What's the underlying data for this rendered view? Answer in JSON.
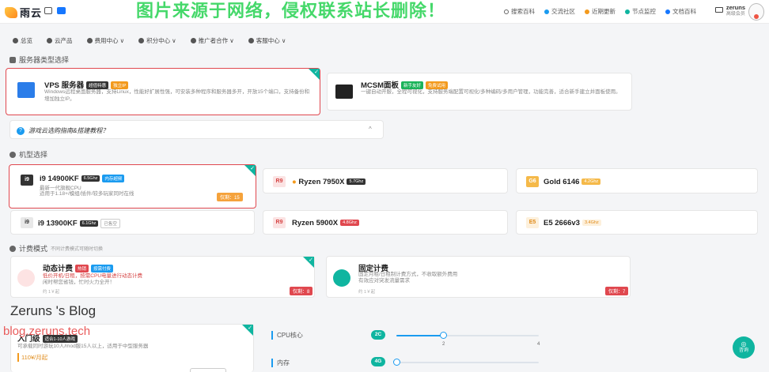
{
  "topbar": {
    "brand": "雨云",
    "watermark": "图片来源于网络，侵权联系站长删除！",
    "links": [
      "搜索百科",
      "交流社区",
      "近期更新",
      "节点监控",
      "文档百科"
    ],
    "link_colors": [
      "#666666",
      "#1a9bf0",
      "#f39a1d",
      "#0fb5a0",
      "#1677ff"
    ],
    "user_name": "zeruns",
    "user_sub": "高级会员"
  },
  "nav": [
    "总览",
    "云产品",
    "费用中心 ∨",
    "积分中心 ∨",
    "推广者合作 ∨",
    "客服中心 ∨"
  ],
  "server_type": {
    "title": "服务器类型选择",
    "cards": [
      {
        "title": "VPS 服务器",
        "badges": [
          "超值特惠",
          "独立IP"
        ],
        "desc": "Windows远程桌面服务器，支持Linux，性能好扩展性强，可安装多种程序和服务器多开，开放15个端口，支持备份和增加独立IP。"
      },
      {
        "title": "MCSM面板",
        "badges": [
          "新手友好",
          "免费试用"
        ],
        "desc": "一键自动开服，全程可视化，支持服务端配置可视化/多种编码/多用户管理，功能完善，适合新手建立并面板使用。"
      }
    ]
  },
  "help": {
    "text": "游戏云选购指南&搭建教程？",
    "chevron": "^"
  },
  "cpu": {
    "title": "机型选择",
    "cards": [
      {
        "chip": "i9",
        "name": "i9 14900KF",
        "badges": [
          "6.5Ghz",
          "内存超频"
        ],
        "desc1": "最新一代旗舰CPU",
        "desc2": "适用于1.18+/模组/插件/较多玩家同时在线",
        "price": "仅剩：15"
      },
      {
        "chip": "R9",
        "name": "Ryzen 7950X",
        "badges": [
          "5.7Ghz"
        ]
      },
      {
        "chip": "G6",
        "name": "Gold 6146",
        "badges": [
          "4.2Ghz"
        ]
      },
      {
        "chip": "i9",
        "name": "i9 13900KF",
        "badges": [
          "6.1Ghz",
          "已售空"
        ]
      },
      {
        "chip": "R9",
        "name": "Ryzen 5900X",
        "badges": [
          "4.8Ghz"
        ]
      },
      {
        "chip": "E5",
        "name": "E5 2666v3",
        "badges": [
          "3.4Ghz"
        ]
      }
    ]
  },
  "billing": {
    "title": "计费模式",
    "subtitle": "不同计费模式可随时切换",
    "cards": [
      {
        "title": "动态计费",
        "badges": [
          "热销",
          "按需付费"
        ],
        "line1": "低价开机/日租，按需CPU电量进行动态计费",
        "line2": "闲时帮您省钱，忙时火力全开！",
        "note": "约 1￥起",
        "price": "仅剩：8"
      },
      {
        "title": "固定计费",
        "line1": "固定月租/日租制计费方式，不收取额外费用",
        "line2": "有效应对突发流量需求",
        "note": "约 1￥起",
        "price": "仅剩：7"
      }
    ]
  },
  "blog": {
    "title": "Zeruns 's Blog",
    "url": "blog.zeruns.tech"
  },
  "plan": {
    "title": "入门级",
    "badge": "适合1-10人游戏",
    "desc": "可承载同时游玩10人/mod服15人以上，适用于中型服务器",
    "price": "110¥/月起"
  },
  "config": {
    "cpu_label": "CPU核心",
    "cpu_value": "2C",
    "cpu_ticks": [
      "2",
      "4"
    ],
    "cpu_level": 2,
    "mem_label": "内存",
    "mem_value": "4G"
  },
  "fab": {
    "label": "咨询"
  }
}
